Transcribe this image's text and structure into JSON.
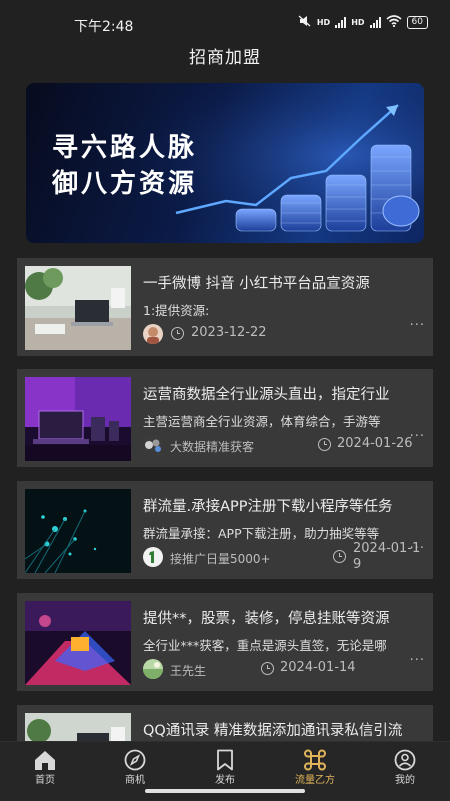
{
  "status_bar": {
    "time": "下午2:48",
    "battery": "60",
    "network_label": "HD"
  },
  "header": {
    "title": "招商加盟"
  },
  "banner": {
    "line1": "寻六路人脉",
    "line2": "御八方资源"
  },
  "posts": [
    {
      "title": "一手微博 抖音 小红书平台品宣资源",
      "description": "1:提供资源:",
      "author": "",
      "date": "2023-12-22",
      "more": "···"
    },
    {
      "title": "运营商数据全行业源头直出，指定行业",
      "description": "主营运营商全行业资源，体育综合，手游等",
      "author": "大数据精准获客",
      "date": "2024-01-26",
      "more": "···"
    },
    {
      "title": "群流量.承接APP注册下载小程序等任务",
      "description": "群流量承接：APP下载注册，助力抽奖等等",
      "author": "接推广日量5000+",
      "date_line1": "2024-01-1",
      "date_line2": "9",
      "more": "···"
    },
    {
      "title": "提供**，股票，装修，停息挂账等资源",
      "description": "全行业***获客，重点是源头直签，无论是哪",
      "author": "王先生",
      "date": "2024-01-14",
      "more": "···"
    },
    {
      "title": "QQ通讯录 精准数据添加通讯录私信引流"
    }
  ],
  "tabs": [
    {
      "label": "首页",
      "icon": "home-icon"
    },
    {
      "label": "商机",
      "icon": "compass-icon"
    },
    {
      "label": "发布",
      "icon": "bookmark-icon"
    },
    {
      "label": "流量乙方",
      "icon": "command-icon",
      "active": true
    },
    {
      "label": "我的",
      "icon": "user-icon"
    }
  ],
  "colors": {
    "background": "#212121",
    "card": "#393939",
    "active_tab": "#e2b55a",
    "banner": "#0b1b48"
  }
}
